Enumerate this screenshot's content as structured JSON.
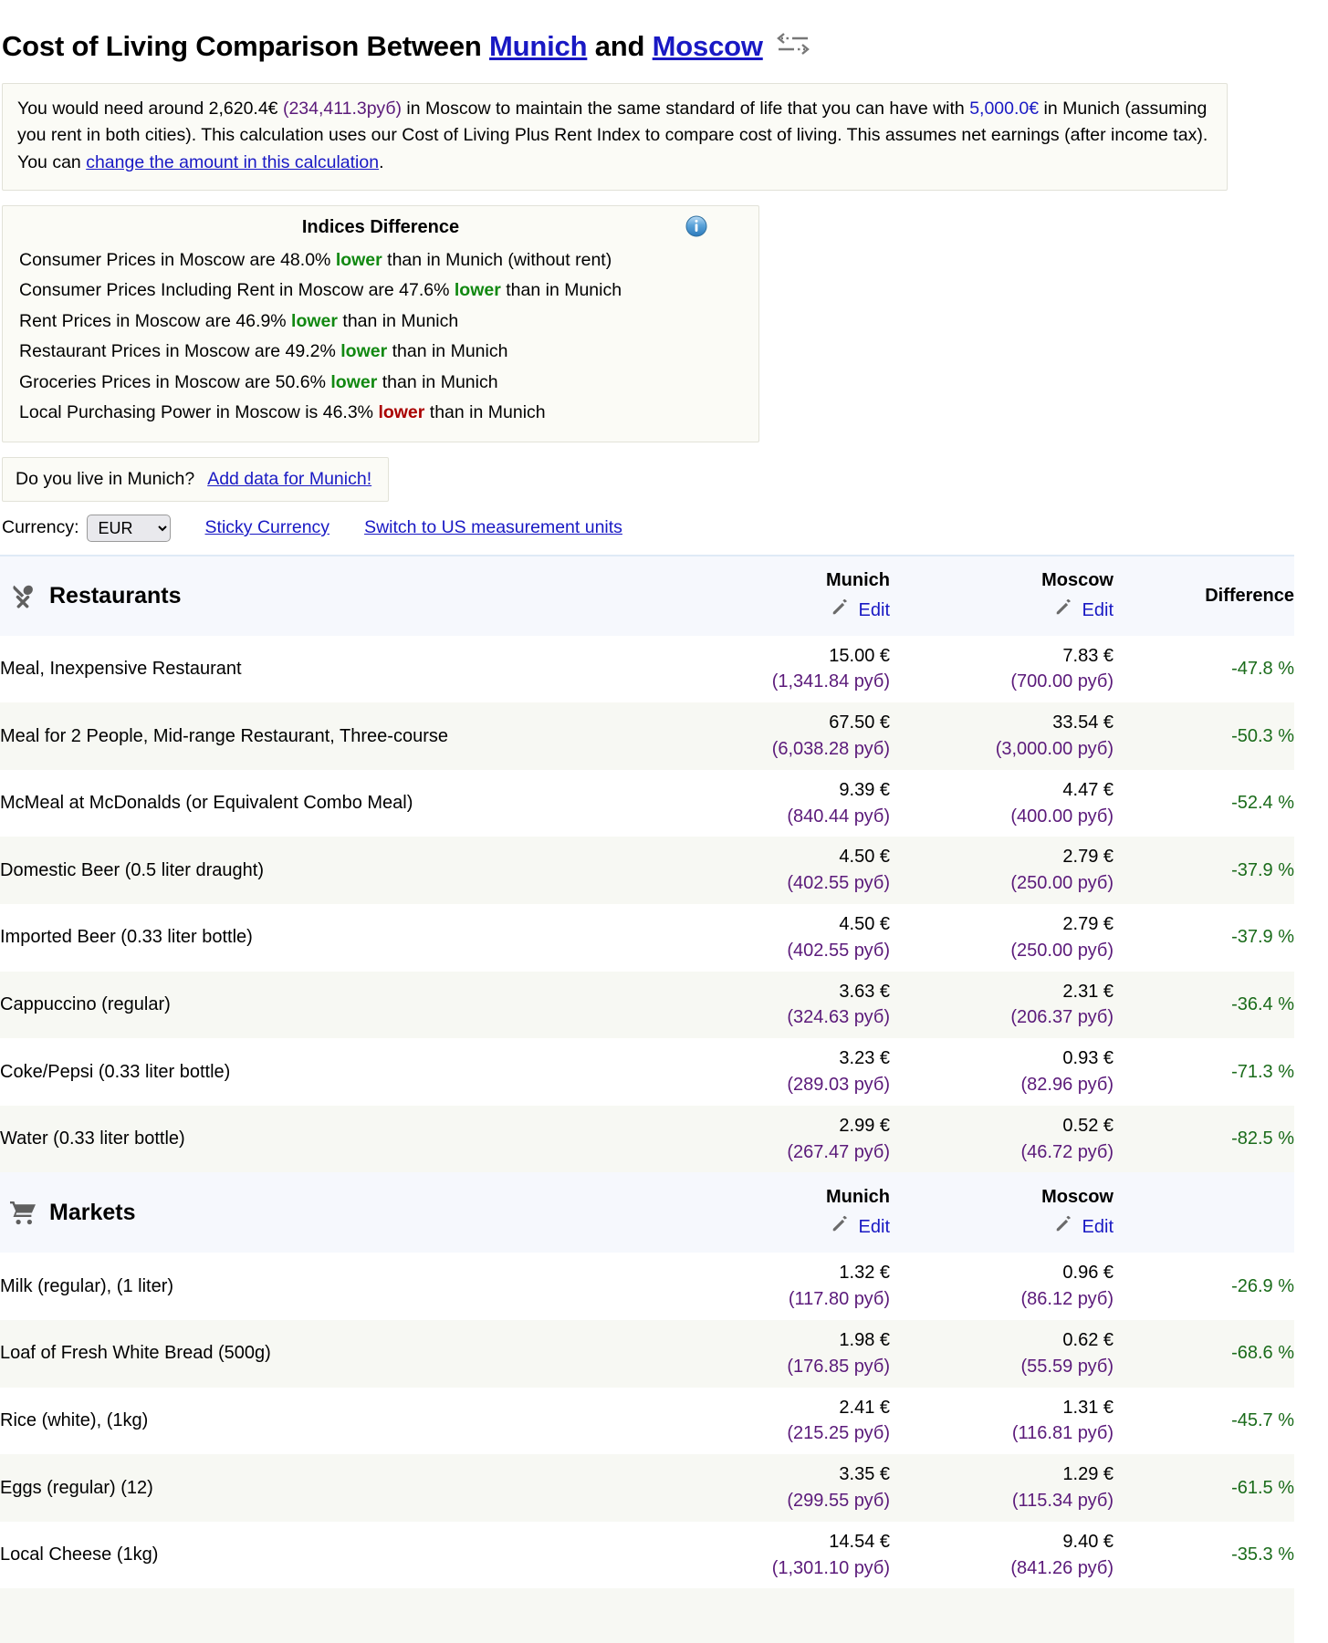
{
  "header": {
    "title_prefix": "Cost of Living Comparison Between ",
    "city_a": "Munich",
    "title_mid": " and ",
    "city_b": "Moscow",
    "swap_icon": "swap-arrows-icon"
  },
  "summary": {
    "seg1": "You would need around 2,620.4€ ",
    "amount_rub": "(234,411.3руб)",
    "seg2": " in Moscow to maintain the same standard of life that you can have with ",
    "amount_eur": "5,000.0€",
    "seg3": " in Munich (assuming you rent in both cities). This calculation uses our Cost of Living Plus Rent Index to compare cost of living. This assumes net earnings (after income tax). You can ",
    "change_link": "change the amount in this calculation",
    "seg4": "."
  },
  "indices": {
    "title": "Indices Difference",
    "info_icon": "info-icon",
    "lines": [
      {
        "pre": "Consumer Prices in Moscow are 48.0% ",
        "word": "lower",
        "tone": "green",
        "post": " than in Munich (without rent)"
      },
      {
        "pre": "Consumer Prices Including Rent in Moscow are 47.6% ",
        "word": "lower",
        "tone": "green",
        "post": " than in Munich"
      },
      {
        "pre": "Rent Prices in Moscow are 46.9% ",
        "word": "lower",
        "tone": "green",
        "post": " than in Munich"
      },
      {
        "pre": "Restaurant Prices in Moscow are 49.2% ",
        "word": "lower",
        "tone": "green",
        "post": " than in Munich"
      },
      {
        "pre": "Groceries Prices in Moscow are 50.6% ",
        "word": "lower",
        "tone": "green",
        "post": " than in Munich"
      },
      {
        "pre": "Local Purchasing Power in Moscow is 46.3% ",
        "word": "lower",
        "tone": "red",
        "post": " than in Munich"
      }
    ]
  },
  "add_data": {
    "question": "Do you live in Munich?",
    "link": "Add data for Munich!"
  },
  "controls": {
    "currency_label": "Currency:",
    "currency_value": "EUR",
    "currency_options": [
      "EUR"
    ],
    "sticky_currency": "Sticky Currency",
    "switch_units": "Switch to US measurement units"
  },
  "table": {
    "col_city_a": "Munich",
    "col_city_b": "Moscow",
    "col_difference": "Difference",
    "edit_label": "Edit",
    "edit_icon": "pencil-icon",
    "sections": [
      {
        "name": "Restaurants",
        "icon": "fork-spoon-icon",
        "rows": [
          {
            "item": "Meal, Inexpensive Restaurant",
            "a_eur": "15.00 €",
            "a_rub": "(1,341.84 руб)",
            "b_eur": "7.83 €",
            "b_rub": "(700.00 руб)",
            "diff": "-47.8 %"
          },
          {
            "item": "Meal for 2 People, Mid-range Restaurant, Three-course",
            "a_eur": "67.50 €",
            "a_rub": "(6,038.28 руб)",
            "b_eur": "33.54 €",
            "b_rub": "(3,000.00 руб)",
            "diff": "-50.3 %"
          },
          {
            "item": "McMeal at McDonalds (or Equivalent Combo Meal)",
            "a_eur": "9.39 €",
            "a_rub": "(840.44 руб)",
            "b_eur": "4.47 €",
            "b_rub": "(400.00 руб)",
            "diff": "-52.4 %"
          },
          {
            "item": "Domestic Beer (0.5 liter draught)",
            "a_eur": "4.50 €",
            "a_rub": "(402.55 руб)",
            "b_eur": "2.79 €",
            "b_rub": "(250.00 руб)",
            "diff": "-37.9 %"
          },
          {
            "item": "Imported Beer (0.33 liter bottle)",
            "a_eur": "4.50 €",
            "a_rub": "(402.55 руб)",
            "b_eur": "2.79 €",
            "b_rub": "(250.00 руб)",
            "diff": "-37.9 %"
          },
          {
            "item": "Cappuccino (regular)",
            "a_eur": "3.63 €",
            "a_rub": "(324.63 руб)",
            "b_eur": "2.31 €",
            "b_rub": "(206.37 руб)",
            "diff": "-36.4 %"
          },
          {
            "item": "Coke/Pepsi (0.33 liter bottle)",
            "a_eur": "3.23 €",
            "a_rub": "(289.03 руб)",
            "b_eur": "0.93 €",
            "b_rub": "(82.96 руб)",
            "diff": "-71.3 %"
          },
          {
            "item": "Water (0.33 liter bottle)",
            "a_eur": "2.99 €",
            "a_rub": "(267.47 руб)",
            "b_eur": "0.52 €",
            "b_rub": "(46.72 руб)",
            "diff": "-82.5 %"
          }
        ]
      },
      {
        "name": "Markets",
        "icon": "shopping-cart-icon",
        "rows": [
          {
            "item": "Milk (regular), (1 liter)",
            "a_eur": "1.32 €",
            "a_rub": "(117.80 руб)",
            "b_eur": "0.96 €",
            "b_rub": "(86.12 руб)",
            "diff": "-26.9 %"
          },
          {
            "item": "Loaf of Fresh White Bread (500g)",
            "a_eur": "1.98 €",
            "a_rub": "(176.85 руб)",
            "b_eur": "0.62 €",
            "b_rub": "(55.59 руб)",
            "diff": "-68.6 %"
          },
          {
            "item": "Rice (white), (1kg)",
            "a_eur": "2.41 €",
            "a_rub": "(215.25 руб)",
            "b_eur": "1.31 €",
            "b_rub": "(116.81 руб)",
            "diff": "-45.7 %"
          },
          {
            "item": "Eggs (regular) (12)",
            "a_eur": "3.35 €",
            "a_rub": "(299.55 руб)",
            "b_eur": "1.29 €",
            "b_rub": "(115.34 руб)",
            "diff": "-61.5 %"
          },
          {
            "item": "Local Cheese (1kg)",
            "a_eur": "14.54 €",
            "a_rub": "(1,301.10 руб)",
            "b_eur": "9.40 €",
            "b_rub": "(841.26 руб)",
            "diff": "-35.3 %"
          }
        ]
      }
    ]
  },
  "colors": {
    "link": "#1919c4",
    "ruble": "#5b1a7a",
    "lower_green": "#118811",
    "lower_red": "#aa0000",
    "diff_green": "#1a6b1a",
    "panel_bg": "#fbfbf6",
    "section_bg": "#f6f8fd",
    "row_odd_bg": "#f7f8f3"
  }
}
